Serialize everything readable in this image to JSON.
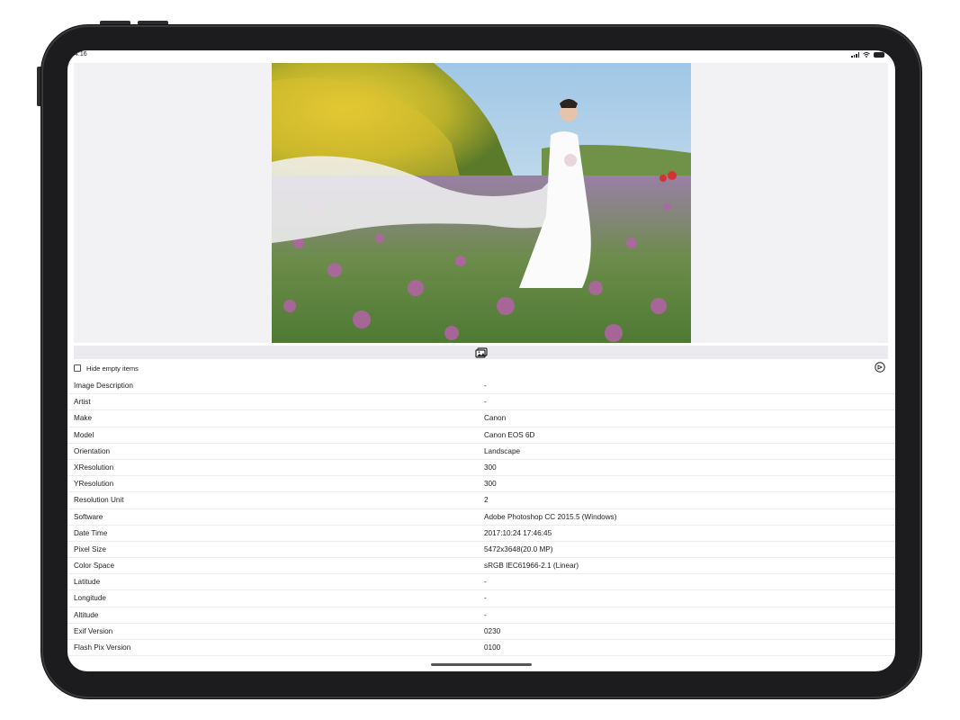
{
  "status_bar": {
    "time": "4:16"
  },
  "controls": {
    "hide_empty_label": "Hide empty items",
    "hide_empty_checked": false
  },
  "icons": {
    "photo_library": "photo-library-icon",
    "share": "share-icon",
    "signal": "signal-icon",
    "wifi": "wifi-icon",
    "battery": "battery-icon"
  },
  "exif": {
    "rows": [
      {
        "key": "Image Description",
        "value": "-"
      },
      {
        "key": "Artist",
        "value": "-"
      },
      {
        "key": "Make",
        "value": "Canon"
      },
      {
        "key": "Model",
        "value": "Canon EOS 6D"
      },
      {
        "key": "Orientation",
        "value": "Landscape"
      },
      {
        "key": "XResolution",
        "value": "300"
      },
      {
        "key": "YResolution",
        "value": "300"
      },
      {
        "key": "Resolution Unit",
        "value": "2"
      },
      {
        "key": "Software",
        "value": "Adobe Photoshop CC 2015.5 (Windows)"
      },
      {
        "key": "Date Time",
        "value": "2017:10:24 17:46:45"
      },
      {
        "key": "Pixel Size",
        "value": "5472x3648(20.0 MP)"
      },
      {
        "key": "Color Space",
        "value": "sRGB IEC61966-2.1 (Linear)"
      },
      {
        "key": "Latitude",
        "value": "-"
      },
      {
        "key": "Longitude",
        "value": "-"
      },
      {
        "key": "Altitude",
        "value": "-"
      },
      {
        "key": "Exif Version",
        "value": "0230"
      },
      {
        "key": "Flash Pix Version",
        "value": "0100"
      }
    ]
  }
}
